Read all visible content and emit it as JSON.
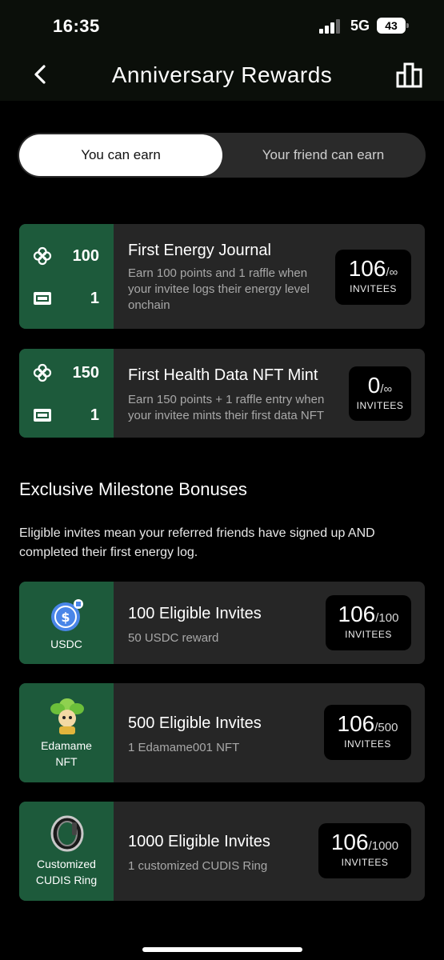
{
  "status": {
    "time": "16:35",
    "network": "5G",
    "battery": "43"
  },
  "header": {
    "title": "Anniversary Rewards"
  },
  "tabs": {
    "you": "You can earn",
    "friend": "Your friend can earn"
  },
  "tasks": [
    {
      "points": "100",
      "raffles": "1",
      "title": "First Energy Journal",
      "desc_lines": [
        "Earn 100 points and 1 raffle when",
        "your invitee logs their energy level",
        "onchain"
      ],
      "count": "106",
      "total": "/∞",
      "unit": "INVITEES"
    },
    {
      "points": "150",
      "raffles": "1",
      "title": "First Health Data NFT Mint",
      "desc_lines": [
        "Earn 150 points + 1 raffle entry when",
        "your invitee mints their first data NFT"
      ],
      "count": "0",
      "total": "/∞",
      "unit": "INVITEES"
    }
  ],
  "section": {
    "title": "Exclusive Milestone Bonuses",
    "desc": "Eligible invites mean your referred friends have signed up AND completed their first energy log."
  },
  "milestones": [
    {
      "label_lines": [
        "USDC"
      ],
      "title": "100 Eligible Invites",
      "desc": "50 USDC reward",
      "count": "106",
      "total": "/100",
      "unit": "INVITEES"
    },
    {
      "label_lines": [
        "Edamame",
        "NFT"
      ],
      "title": "500 Eligible Invites",
      "desc": "1 Edamame001 NFT",
      "count": "106",
      "total": "/500",
      "unit": "INVITEES"
    },
    {
      "label_lines": [
        "Customized",
        "CUDIS Ring"
      ],
      "title": "1000 Eligible Invites",
      "desc": "1 customized CUDIS Ring",
      "count": "106",
      "total": "/1000",
      "unit": "INVITEES"
    }
  ],
  "icons": {
    "points": "points-clover-icon",
    "raffle": "raffle-ticket-icon",
    "usdc": "usdc-coin-icon",
    "edamame": "edamame-nft-icon",
    "ring": "cudis-ring-icon"
  },
  "colors": {
    "green": "#1d5a3b",
    "card": "#262626",
    "toggle": "#2a2a2a"
  }
}
